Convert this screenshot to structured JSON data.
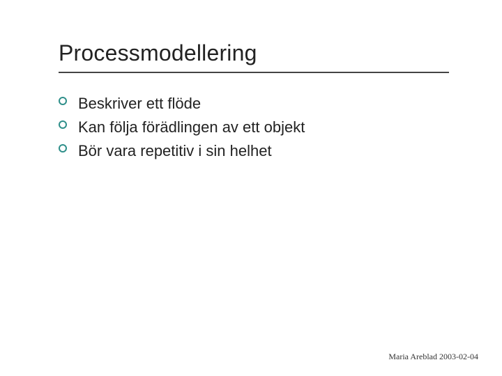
{
  "title": "Processmodellering",
  "bullets": [
    "Beskriver ett flöde",
    "Kan följa förädlingen av ett objekt",
    "Bör vara repetitiv i sin helhet"
  ],
  "footer": "Maria Areblad 2003-02-04",
  "colors": {
    "accent": "#2f8f8a",
    "text": "#222222",
    "underline": "#444444"
  }
}
